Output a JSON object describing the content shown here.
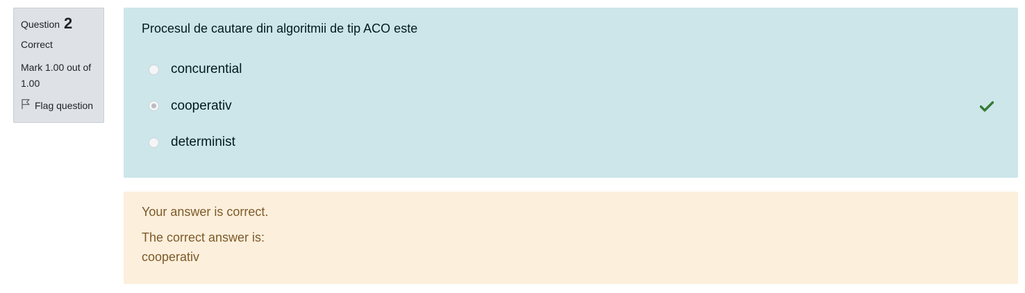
{
  "info": {
    "question_label": "Question",
    "question_number": "2",
    "state": "Correct",
    "grade": "Mark 1.00 out of 1.00",
    "flag_label": "Flag question"
  },
  "question": {
    "text": "Procesul de cautare din algoritmii de tip ACO este",
    "answers": [
      {
        "label": "concurential",
        "checked": false,
        "correct": false
      },
      {
        "label": "cooperativ",
        "checked": true,
        "correct": true
      },
      {
        "label": "determinist",
        "checked": false,
        "correct": false
      }
    ]
  },
  "feedback": {
    "general": "Your answer is correct.",
    "right_answer_label": "The correct answer is:",
    "right_answer_value": "cooperativ"
  },
  "colors": {
    "formulation_bg": "#cce6ea",
    "feedback_bg": "#fcefdc",
    "info_bg": "#dee2e6",
    "correct_tick": "#357a32"
  }
}
